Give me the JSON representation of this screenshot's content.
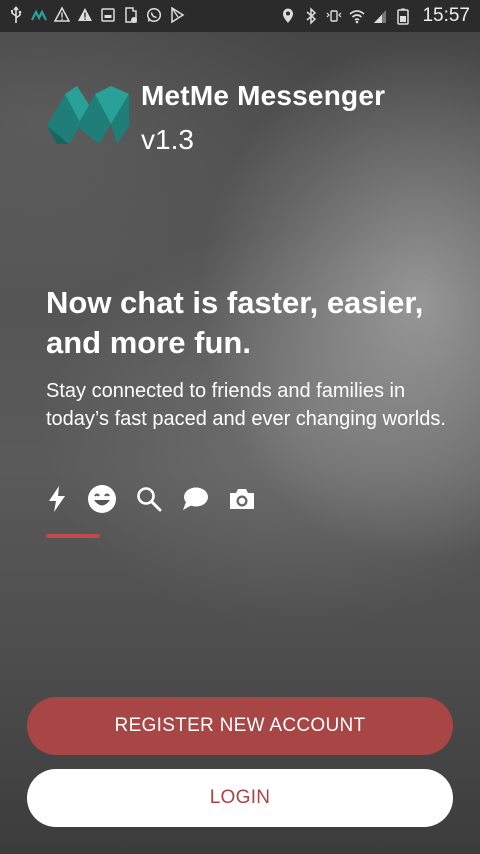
{
  "status_bar": {
    "time": "15:57",
    "icons": [
      "usb-icon",
      "app-notification-icon",
      "warning-icon",
      "warning-filled-icon",
      "image-icon",
      "file-icon",
      "whatsapp-icon",
      "play-store-icon",
      "location-icon",
      "bluetooth-icon",
      "vibrate-icon",
      "wifi-icon",
      "signal-icon",
      "battery-icon"
    ]
  },
  "header": {
    "title": "MetMe Messenger",
    "version": "v1.3"
  },
  "intro": {
    "headline": "Now chat is faster, easier, and more fun.",
    "description": "Stay connected to friends and families in today’s fast paced and ever changing worlds."
  },
  "features": [
    "lightning-icon",
    "smiley-icon",
    "search-icon",
    "chat-bubble-icon",
    "camera-icon"
  ],
  "actions": {
    "register_label": "REGISTER NEW ACCOUNT",
    "login_label": "LOGIN"
  },
  "colors": {
    "accent": "#a84545",
    "logo_teal": "#2aa198",
    "text": "#ffffff"
  }
}
